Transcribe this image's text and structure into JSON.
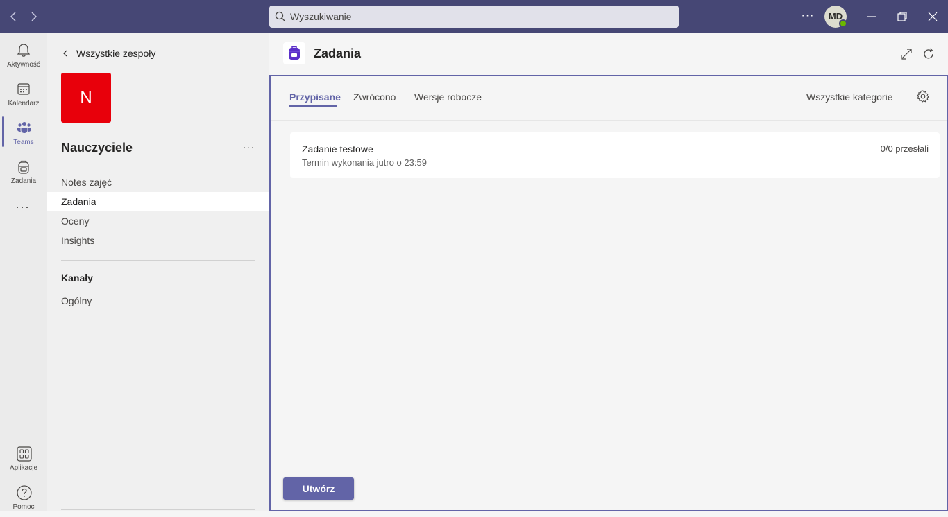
{
  "titlebar": {
    "back_icon": "chevron-left-icon",
    "forward_icon": "chevron-right-icon",
    "search_placeholder": "Wyszukiwanie",
    "more_label": "···",
    "avatar_initials": "MD",
    "presence_color": "#6bb700"
  },
  "rail": {
    "items": [
      {
        "label": "Aktywność",
        "icon": "bell-icon"
      },
      {
        "label": "Kalendarz",
        "icon": "calendar-icon"
      },
      {
        "label": "Teams",
        "icon": "teams-icon",
        "active": true
      },
      {
        "label": "Zadania",
        "icon": "backpack-icon"
      }
    ],
    "more_label": "···",
    "bottom_items": [
      {
        "label": "Aplikacje",
        "icon": "apps-icon"
      },
      {
        "label": "Pomoc",
        "icon": "help-icon"
      }
    ]
  },
  "sidebar": {
    "back_label": "Wszystkie zespoły",
    "team_initial": "N",
    "team_color": "#e8000b",
    "team_name": "Nauczyciele",
    "team_more": "···",
    "items": [
      {
        "label": "Notes zajęć"
      },
      {
        "label": "Zadania",
        "active": true
      },
      {
        "label": "Oceny"
      },
      {
        "label": "Insights"
      }
    ],
    "channels_header": "Kanały",
    "channels": [
      {
        "label": "Ogólny"
      }
    ]
  },
  "app": {
    "title": "Zadania",
    "accent": "#6264a7",
    "tabs": [
      {
        "label": "Przypisane",
        "active": true
      },
      {
        "label": "Zwrócono"
      },
      {
        "label": "Wersje robocze"
      }
    ],
    "category_filter": "Wszystkie kategorie",
    "assignments": [
      {
        "title": "Zadanie testowe",
        "due": "Termin wykonania jutro o 23:59",
        "count": "0/0 przesłali"
      }
    ],
    "create_label": "Utwórz"
  }
}
